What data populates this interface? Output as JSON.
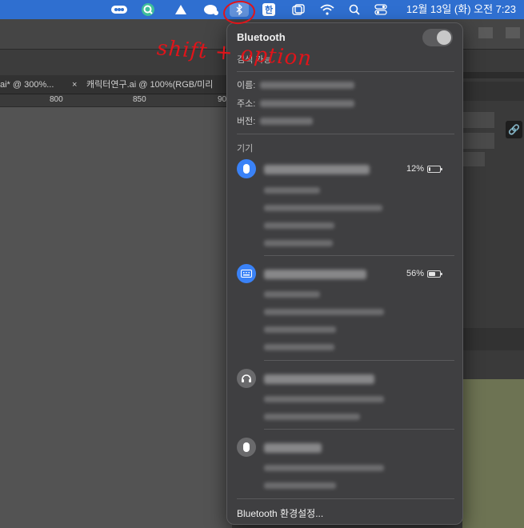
{
  "menubar": {
    "icons": [
      "menu-extra-dots-icon",
      "magnifier-q-icon",
      "triangle-icon",
      "messages-icon",
      "bluetooth-icon",
      "input-source-icon",
      "window-icon",
      "wifi-icon",
      "spotlight-icon",
      "control-center-icon"
    ],
    "input_source": "한",
    "clock": "12월 13일 (화) 오전  7:23"
  },
  "app": {
    "tabs": [
      "ai* @ 300%...",
      "×",
      "캐릭터연구.ai @ 100%(RGB/미리"
    ],
    "ruler": [
      "800",
      "850",
      "90"
    ]
  },
  "bluetooth": {
    "title": "Bluetooth",
    "toggle_on": true,
    "subtitle": "검색 가능",
    "info_labels": [
      "이름:",
      "주소:",
      "버전:"
    ],
    "section": "기기",
    "devices": [
      {
        "type": "mouse",
        "battery": "12%",
        "battery_level": 0.12,
        "details": 4,
        "icon": "mouse-icon"
      },
      {
        "type": "keyboard",
        "battery": "56%",
        "battery_level": 0.56,
        "details": 4,
        "icon": "keyboard-icon"
      },
      {
        "type": "headphones",
        "battery": null,
        "details": 2,
        "icon": "headphones-icon"
      },
      {
        "type": "mouse",
        "battery": null,
        "details": 2,
        "icon": "mouse-icon"
      }
    ],
    "prefs_label": "Bluetooth 환경설정..."
  },
  "annotation": {
    "text": "shift + option",
    "color": "#e0141a"
  },
  "colors": {
    "menubar": "#2f6fd0",
    "menu_bg": "#3f3f41",
    "device_blue": "#3a82f7"
  }
}
